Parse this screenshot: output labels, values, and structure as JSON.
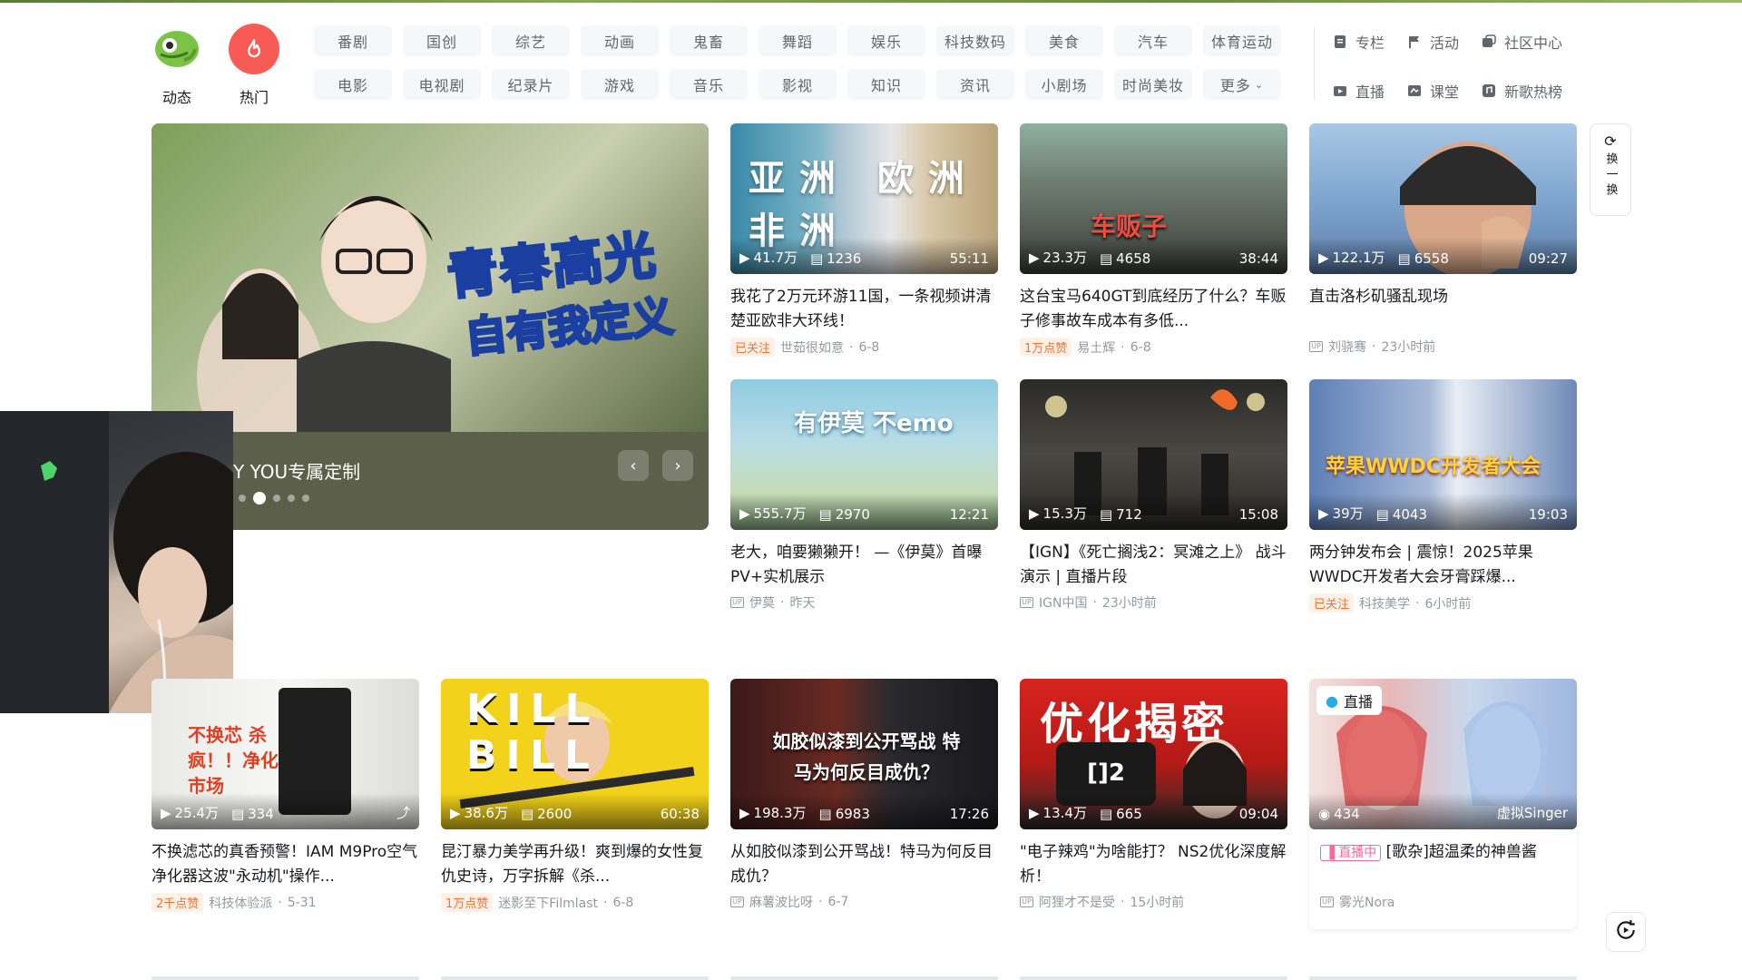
{
  "header": {
    "nav_icons": [
      {
        "label": "动态",
        "icon": "chameleon-icon"
      },
      {
        "label": "热门",
        "icon": "flame-icon"
      }
    ],
    "categories": [
      "番剧",
      "国创",
      "综艺",
      "动画",
      "鬼畜",
      "舞蹈",
      "娱乐",
      "科技数码",
      "美食",
      "汽车",
      "体育运动",
      "电影",
      "电视剧",
      "纪录片",
      "游戏",
      "音乐",
      "影视",
      "知识",
      "资讯",
      "小剧场",
      "时尚美妆",
      "更多"
    ],
    "tools": [
      {
        "label": "专栏",
        "icon": "article-icon"
      },
      {
        "label": "活动",
        "icon": "flag-icon"
      },
      {
        "label": "社区中心",
        "icon": "community-icon"
      },
      {
        "label": "直播",
        "icon": "live-icon"
      },
      {
        "label": "课堂",
        "icon": "classroom-icon"
      },
      {
        "label": "新歌热榜",
        "icon": "music-chart-icon"
      }
    ]
  },
  "hero": {
    "title": "Y YOU专属定制",
    "overlay_line1": "青春高光",
    "overlay_line2": "自有我定义",
    "dots": 5,
    "active_dot": 1
  },
  "side": {
    "refresh_label": "换一换"
  },
  "colors": {
    "brand_pink": "#fb7299",
    "accent_orange": "#ff6f2c",
    "live_pink": "#ff6699"
  },
  "cards": [
    {
      "views": "41.7万",
      "danmaku": "1236",
      "duration": "55:11",
      "title": "我花了2万元环游11国，一条视频讲清楚亚欧非大环线！",
      "badge": "已关注",
      "author": "世茹很如意",
      "date": "6-8",
      "thumb_text": "亚洲 欧洲 非洲"
    },
    {
      "views": "23.3万",
      "danmaku": "4658",
      "duration": "38:44",
      "title": "这台宝马640GT到底经历了什么？车贩子修事故车成本有多低...",
      "badge": "1万点赞",
      "author": "易土辉",
      "date": "6-8",
      "thumb_text": "车贩子"
    },
    {
      "views": "122.1万",
      "danmaku": "6558",
      "duration": "09:27",
      "title": "直击洛杉矶骚乱现场",
      "badge": "",
      "author": "刘骁骞",
      "date": "23小时前",
      "thumb_text": ""
    },
    {
      "views": "555.7万",
      "danmaku": "2970",
      "duration": "12:21",
      "title": "老大，咱要獭獭开！ —《伊莫》首曝PV+实机展示",
      "badge": "",
      "author": "伊莫",
      "date": "昨天",
      "thumb_text": "有伊莫 不emo"
    },
    {
      "views": "15.3万",
      "danmaku": "712",
      "duration": "15:08",
      "title": "【IGN】《死亡搁浅2：冥滩之上》 战斗演示 | 直播片段",
      "badge": "",
      "author": "IGN中国",
      "date": "23小时前",
      "thumb_text": ""
    },
    {
      "views": "39万",
      "danmaku": "4043",
      "duration": "19:03",
      "title": "两分钟发布会 | 震惊！2025苹果WWDC开发者大会牙膏踩爆...",
      "badge": "已关注",
      "author": "科技美学",
      "date": "6小时前",
      "thumb_text": "苹果WWDC开发者大会"
    },
    {
      "views": "25.4万",
      "danmaku": "334",
      "duration": "",
      "title": "不换滤芯的真香预警！IAM M9Pro空气净化器这波\"永动机\"操作...",
      "badge": "2千点赞",
      "author": "科技体验派",
      "date": "5-31",
      "thumb_text": "不换芯 杀疯！！净化市场"
    },
    {
      "views": "38.6万",
      "danmaku": "2600",
      "duration": "60:38",
      "title": "昆汀暴力美学再升级！爽到爆的女性复仇史诗，万字拆解《杀...",
      "badge": "1万点赞",
      "author": "迷影至下Filmlast",
      "date": "6-8",
      "thumb_text": "KILL BILL"
    },
    {
      "views": "198.3万",
      "danmaku": "6983",
      "duration": "17:26",
      "title": "从如胶似漆到公开骂战！特马为何反目成仇？",
      "badge": "",
      "author": "麻薯波比呀",
      "date": "6-7",
      "thumb_text": "如胶似漆到公开骂战 特马为何反目成仇？"
    },
    {
      "views": "13.4万",
      "danmaku": "665",
      "duration": "09:04",
      "title": "\"电子辣鸡\"为啥能打？ NS2优化深度解析！",
      "badge": "",
      "author": "阿狸才不是受",
      "date": "15小时前",
      "thumb_text": "优化揭密"
    },
    {
      "views": "434",
      "danmaku": "",
      "duration": "",
      "title": "[歌杂]超温柔的神兽酱",
      "badge": "",
      "author": "雾光Nora",
      "date": "",
      "live_tag": "直播",
      "live_badge": "直播中",
      "streamer": "虚拟Singer",
      "thumb_text": ""
    }
  ]
}
